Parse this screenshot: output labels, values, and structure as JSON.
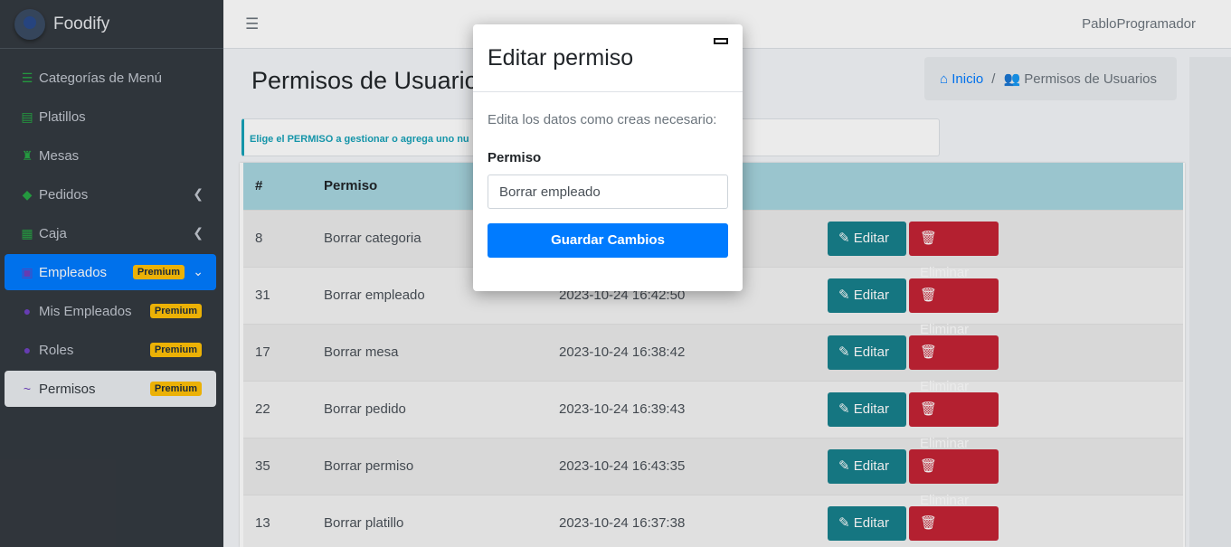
{
  "brand": {
    "name": "Foodify"
  },
  "sidebar": {
    "items": [
      {
        "label": "Categorías de Menú",
        "icon": "list-icon"
      },
      {
        "label": "Platillos",
        "icon": "dish-icon"
      },
      {
        "label": "Mesas",
        "icon": "chair-icon"
      },
      {
        "label": "Pedidos",
        "icon": "tags-icon"
      },
      {
        "label": "Caja",
        "icon": "cash-register-icon"
      },
      {
        "label": "Empleados",
        "icon": "users-icon",
        "badge": "Premium"
      },
      {
        "label": "Mis Empleados",
        "icon": "users-icon",
        "badge": "Premium"
      },
      {
        "label": "Roles",
        "icon": "user-tie-icon",
        "badge": "Premium"
      },
      {
        "label": "Permisos",
        "icon": "signature-icon",
        "badge": "Premium"
      }
    ]
  },
  "topbar": {
    "user": "PabloProgramador"
  },
  "page": {
    "title": "Permisos de Usuarios",
    "breadcrumb": {
      "home": "Inicio",
      "current": "Permisos de Usuarios"
    },
    "alert": "Elige el PERMISO a gestionar o agrega uno nu"
  },
  "table": {
    "headers": {
      "id": "#",
      "permiso": "Permiso"
    },
    "rows": [
      {
        "id": "8",
        "permiso": "Borrar categoria",
        "fecha": ""
      },
      {
        "id": "31",
        "permiso": "Borrar empleado",
        "fecha": "2023-10-24 16:42:50"
      },
      {
        "id": "17",
        "permiso": "Borrar mesa",
        "fecha": "2023-10-24 16:38:42"
      },
      {
        "id": "22",
        "permiso": "Borrar pedido",
        "fecha": "2023-10-24 16:39:43"
      },
      {
        "id": "35",
        "permiso": "Borrar permiso",
        "fecha": "2023-10-24 16:43:35"
      },
      {
        "id": "13",
        "permiso": "Borrar platillo",
        "fecha": "2023-10-24 16:37:38"
      }
    ],
    "edit_label": "Editar",
    "delete_label": "Eliminar"
  },
  "modal": {
    "title": "Editar permiso",
    "description": "Edita los datos como creas necesario:",
    "field_label": "Permiso",
    "field_value": "Borrar empleado",
    "save_label": "Guardar Cambios"
  },
  "colors": {
    "sidebar_bg": "#343a40",
    "primary": "#007bff",
    "edit_button": "#17808c",
    "delete_button": "#c42335",
    "badge": "#ffc107",
    "table_header": "#a8d6e0"
  }
}
